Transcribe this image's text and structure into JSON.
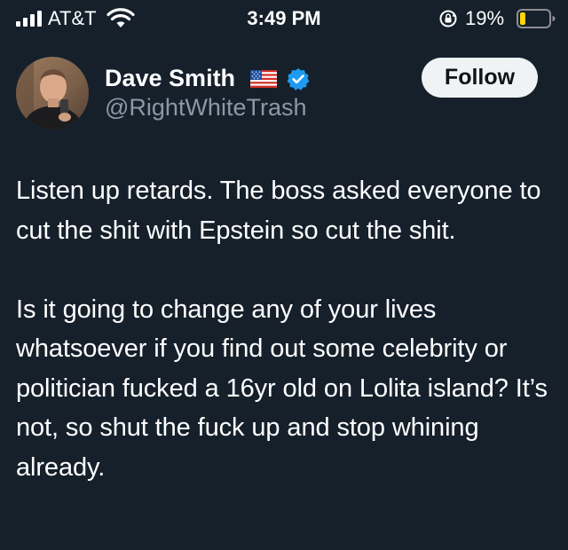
{
  "status_bar": {
    "carrier": "AT&T",
    "time": "3:49 PM",
    "battery_percent": "19%",
    "signal_bars": 4,
    "battery_level": 0.19,
    "battery_color": "#ffd60a"
  },
  "tweet": {
    "author": {
      "display_name": "Dave Smith",
      "handle": "@RightWhiteTrash",
      "verified": true,
      "flag": "us-flag-icon"
    },
    "follow_label": "Follow",
    "paragraphs": [
      "Listen up retards. The boss asked everyone to cut the shit with Epstein so cut the shit.",
      "Is it going to change any of your lives whatsoever if you find out some celebrity or politician fucked a 16yr old on Lolita island? It’s not, so shut the fuck up and stop whining already."
    ]
  },
  "colors": {
    "background": "#15202b",
    "text": "#ffffff",
    "secondary_text": "#8b98a5",
    "verified_blue": "#1d9bf0",
    "button_bg": "#eff3f4",
    "button_text": "#0f1419"
  }
}
